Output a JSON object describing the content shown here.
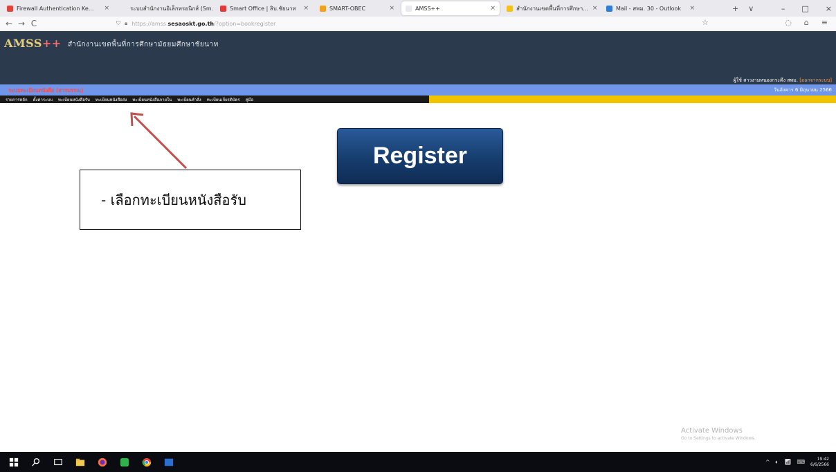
{
  "browser": {
    "tabs": [
      {
        "label": "Firewall Authentication Ke...",
        "color": "#e0443a",
        "active": false
      },
      {
        "label": "ระบบสำนักงานอิเล็กทรอนิกส์ (Sm...",
        "color": "#e9e9ee",
        "active": false
      },
      {
        "label": "Smart Office | ลิบ.ชัยนาท",
        "color": "#e33b3b",
        "active": false
      },
      {
        "label": "SMART-OBEC",
        "color": "#f1a020",
        "active": false
      },
      {
        "label": "AMSS++",
        "color": "#e9e9ee",
        "active": true
      },
      {
        "label": "สำนักงานเขตพื้นที่การศึกษา...",
        "color": "#f3c11a",
        "active": false
      },
      {
        "label": "Mail - สพม. 30 - Outlook",
        "color": "#2f7dd6",
        "active": false
      }
    ],
    "new_tab": "+",
    "tab_list": "∨",
    "window_controls": {
      "minimize": "–",
      "maximize": "□",
      "close": "×"
    },
    "nav": {
      "back": "←",
      "forward": "→",
      "reload": "C"
    },
    "url": {
      "prefix": "https://amss.",
      "domain": "sesaoskt.go.th",
      "path": "/?option=bookregister"
    },
    "bookmark_icon": "☆",
    "right_icons": [
      "shield",
      "profile",
      "menu"
    ]
  },
  "app": {
    "brand": "AMSS",
    "brand_plus": "++",
    "org_name": "สำนักงานเขตพื้นที่การศึกษามัธยมศึกษาชัยนาท",
    "user_label": "ผู้ใช้",
    "user_name": "สาวงามหนองกระดึง สพม.",
    "logout": "[ออกจากระบบ]",
    "system_name": "ระบบทะเบียนหนังสือ (สารบรรณ)",
    "date_text": "วันอังคาร 6 มิถุนายน 2566",
    "menu": [
      "รายการหลัก",
      "ตั้งค่าระบบ",
      "ทะเบียนหนังสือรับ",
      "ทะเบียนหนังสือส่ง",
      "ทะเบียนหนังสือภายใน",
      "ทะเบียนคำสั่ง",
      "ทะเบียนเกียรติบัตร",
      "คู่มือ"
    ],
    "register_button": "Register"
  },
  "annotation": {
    "text": "-  เลือกทะเบียนหนังสือรับ",
    "arrow_color": "#c0504d"
  },
  "watermark": {
    "title": "Activate Windows",
    "subtitle": "Go to Settings to activate Windows."
  },
  "taskbar": {
    "time": "19:42",
    "date": "6/6/2566"
  }
}
